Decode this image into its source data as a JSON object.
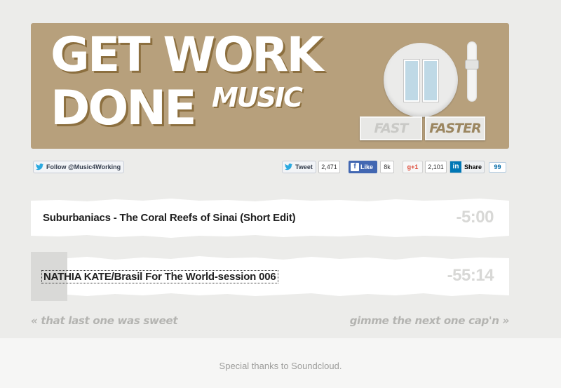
{
  "header": {
    "logo_line1": "GET WORK",
    "logo_line2": "DONE",
    "logo_music": "MUSIC",
    "speed_fast": "FAST",
    "speed_faster": "FASTER"
  },
  "social": {
    "follow_label": "Follow @Music4Working",
    "tweet_label": "Tweet",
    "tweet_count": "2,471",
    "like_label": "Like",
    "like_count": "8k",
    "gplus_label": "+1",
    "gplus_count": "2,101",
    "share_label": "Share",
    "share_count": "99"
  },
  "tracks": [
    {
      "title": "Suburbaniacs - The Coral Reefs of Sinai (Short Edit)",
      "time": "-5:00"
    },
    {
      "title": "NATHIA KATE/Brasil For The World-session 006",
      "time": "-55:14"
    }
  ],
  "nav": {
    "prev_label": "« that last one was sweet",
    "next_label": "gimme the next one cap'n »"
  },
  "footer": {
    "credits": "Special thanks to Soundcloud."
  },
  "colors": {
    "banner": "#b7a07c",
    "pause_bar": "#bfd9e6",
    "facebook": "#4267b2",
    "linkedin": "#0077b5"
  }
}
